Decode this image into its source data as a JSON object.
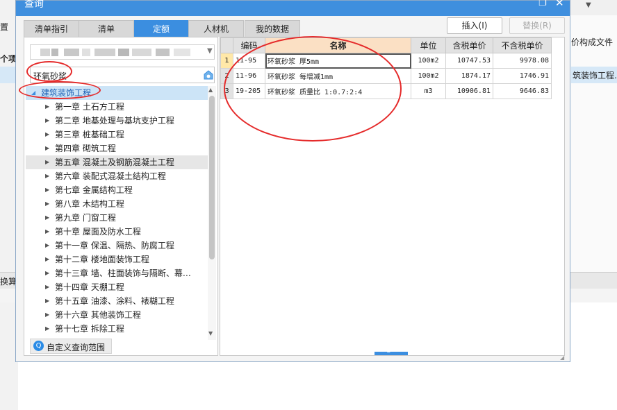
{
  "background": {
    "left_label_top": "置",
    "left_label_item": "个项",
    "left_label_bottom": "换算",
    "right_tab": "价构成文件",
    "right_selected_item": "筑装饰工程…",
    "dropdown_caret": "▼"
  },
  "dialog": {
    "title": "查询",
    "restore_glyph": "❐",
    "close_glyph": "✕",
    "tabs": [
      {
        "label": "清单指引",
        "active": false
      },
      {
        "label": "清单",
        "active": false
      },
      {
        "label": "定额",
        "active": true
      },
      {
        "label": "人材机",
        "active": false
      },
      {
        "label": "我的数据",
        "active": false
      }
    ],
    "insert_button": "插入(I)",
    "replace_button": "替换(R)"
  },
  "left": {
    "search_value": "环氧砂浆",
    "search_button_icon": "search-library-icon",
    "tree": [
      {
        "label": "建筑装饰工程",
        "level": 0,
        "expanded": true,
        "selected": true
      },
      {
        "label": "第一章 土石方工程",
        "level": 1
      },
      {
        "label": "第二章 地基处理与基坑支护工程",
        "level": 1
      },
      {
        "label": "第三章 桩基础工程",
        "level": 1
      },
      {
        "label": "第四章 砌筑工程",
        "level": 1
      },
      {
        "label": "第五章 混凝土及钢筋混凝土工程",
        "level": 1,
        "hover": true
      },
      {
        "label": "第六章 装配式混凝土结构工程",
        "level": 1
      },
      {
        "label": "第七章 金属结构工程",
        "level": 1
      },
      {
        "label": "第八章 木结构工程",
        "level": 1
      },
      {
        "label": "第九章 门窗工程",
        "level": 1
      },
      {
        "label": "第十章 屋面及防水工程",
        "level": 1
      },
      {
        "label": "第十一章 保温、隔热、防腐工程",
        "level": 1
      },
      {
        "label": "第十二章 楼地面装饰工程",
        "level": 1
      },
      {
        "label": "第十三章 墙、柱面装饰与隔断、幕…",
        "level": 1
      },
      {
        "label": "第十四章 天棚工程",
        "level": 1
      },
      {
        "label": "第十五章 油漆、涂料、裱糊工程",
        "level": 1
      },
      {
        "label": "第十六章 其他装饰工程",
        "level": 1
      },
      {
        "label": "第十七章 拆除工程",
        "level": 1
      }
    ],
    "custom_scope_label": "自定义查询范围",
    "custom_scope_icon": "search-icon"
  },
  "grid": {
    "columns": [
      "",
      "编码",
      "名称",
      "单位",
      "含税单价",
      "不含税单价"
    ],
    "sorted_column": 2,
    "rows": [
      {
        "num": "1",
        "code": "11-95",
        "name": "环氧砂浆 厚5mm",
        "unit": "100m2",
        "price_tax": "10747.53",
        "price_notax": "9978.08"
      },
      {
        "num": "2",
        "code": "11-96",
        "name": "环氧砂浆 每增减1mm",
        "unit": "100m2",
        "price_tax": "1874.17",
        "price_notax": "1746.91"
      },
      {
        "num": "3",
        "code": "19-205",
        "name": "环氧砂浆 质量比 1:0.7:2:4",
        "unit": "m3",
        "price_tax": "10906.81",
        "price_notax": "9646.83"
      }
    ]
  },
  "colors": {
    "title_bar": "#3f8fde",
    "active_tab": "#3b8ee0",
    "tree_selected": "#cce4f7",
    "annotation": "#e52b2b",
    "sorted_header": "#fbe0c4"
  }
}
